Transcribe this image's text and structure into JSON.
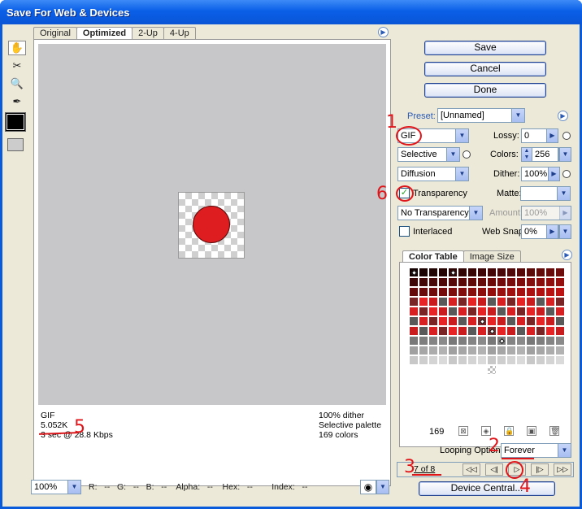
{
  "window": {
    "title": "Save For Web & Devices"
  },
  "tabs": [
    {
      "label": "Original",
      "active": false
    },
    {
      "label": "Optimized",
      "active": true
    },
    {
      "label": "2-Up",
      "active": false
    },
    {
      "label": "4-Up",
      "active": false
    }
  ],
  "tools": [
    "hand-tool",
    "slice-select-tool",
    "zoom-tool",
    "eyedropper-tool"
  ],
  "eyedropper_color": "#000000",
  "preview_info": {
    "format": "GIF",
    "size": "5.052K",
    "download": "3 sec @ 28.8 Kbps",
    "dither": "100% dither",
    "palette": "Selective palette",
    "colors": "169 colors"
  },
  "buttons": {
    "save": "Save",
    "cancel": "Cancel",
    "done": "Done",
    "device_central": "Device Central..."
  },
  "settings": {
    "preset_label": "Preset:",
    "preset_value": "[Unnamed]",
    "format": "GIF",
    "lossy_label": "Lossy:",
    "lossy_value": "0",
    "reduction": "Selective",
    "colors_label": "Colors:",
    "colors_value": "256",
    "dither_algorithm": "Diffusion",
    "dither_label": "Dither:",
    "dither_value": "100%",
    "transparency_label": "Transparency",
    "transparency_checked": true,
    "matte_label": "Matte:",
    "matte_value": "",
    "transparency_dither": "No Transparency ...",
    "amount_label": "Amount:",
    "amount_value": "100%",
    "interlaced_label": "Interlaced",
    "interlaced_checked": false,
    "websnap_label": "Web Snap:",
    "websnap_value": "0%"
  },
  "color_table": {
    "tab_color_table": "Color Table",
    "tab_image_size": "Image Size",
    "count": "169"
  },
  "animation": {
    "looping_label": "Looping Options:",
    "looping_value": "Forever",
    "frame": "7 of 8"
  },
  "status_bar": {
    "zoom": "100%",
    "readout": "R:   --   G:   --   B:   --    Alpha:   --    Hex:   --        Index:   --"
  },
  "annotations": [
    "1",
    "2",
    "3",
    "4",
    "5",
    "6"
  ],
  "colors": {
    "accent_red": "#dd1d1f",
    "annotation_red": "#e0151a",
    "titlebar_blue": "#0a5fe7"
  }
}
